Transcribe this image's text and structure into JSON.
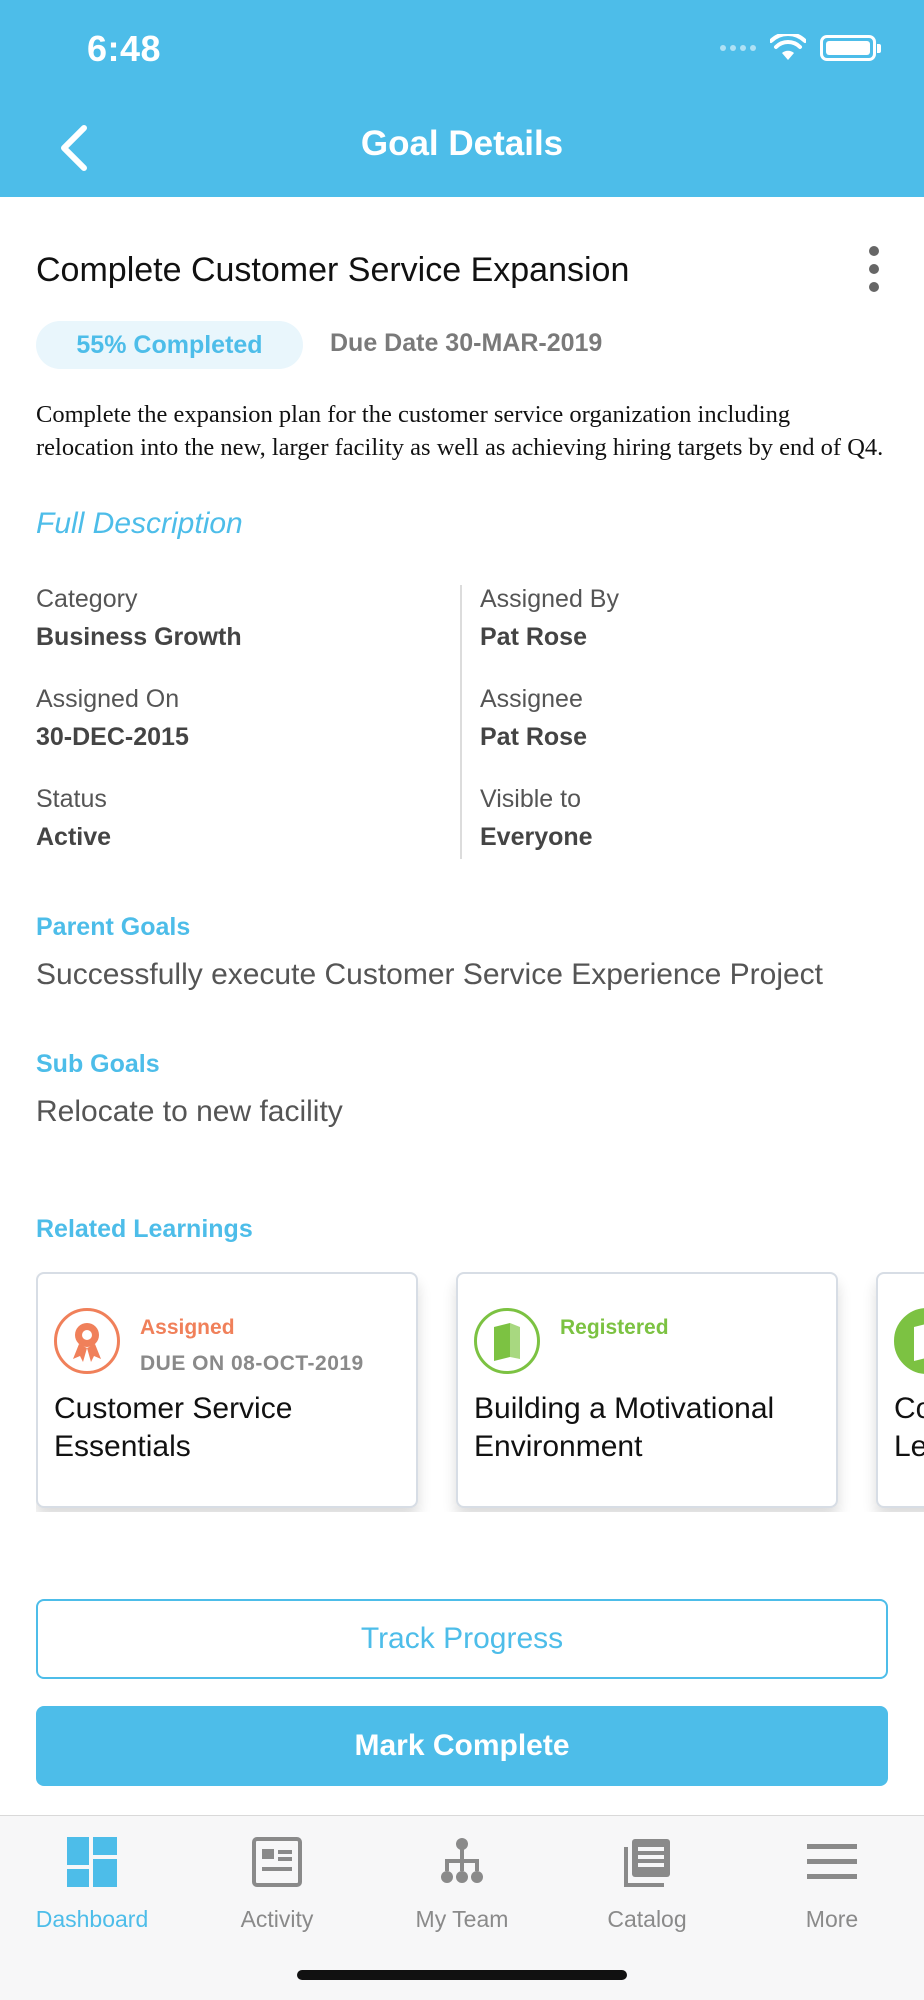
{
  "status_bar": {
    "time": "6:48"
  },
  "header": {
    "title": "Goal Details"
  },
  "goal": {
    "title": "Complete Customer Service Expansion",
    "progress_label": "55% Completed",
    "progress_value": 55,
    "due_date": "Due Date 30-MAR-2019",
    "description": "Complete the expansion plan for the customer service organization including relocation into the new, larger facility as well as achieving hiring targets by end of Q4.",
    "full_description_link": "Full Description"
  },
  "fields": {
    "category_label": "Category",
    "category_value": "Business Growth",
    "assigned_on_label": "Assigned On",
    "assigned_on_value": "30-DEC-2015",
    "status_label": "Status",
    "status_value": "Active",
    "assigned_by_label": "Assigned By",
    "assigned_by_value": "Pat Rose",
    "assignee_label": "Assignee",
    "assignee_value": "Pat Rose",
    "visible_to_label": "Visible to",
    "visible_to_value": "Everyone"
  },
  "parent_goals": {
    "label": "Parent Goals",
    "items": [
      "Successfully execute Customer Service Experience Project"
    ]
  },
  "sub_goals": {
    "label": "Sub Goals",
    "items": [
      "Relocate to new facility"
    ]
  },
  "related_learnings": {
    "label": "Related Learnings",
    "cards": [
      {
        "status": "Assigned",
        "due": "DUE ON 08-OCT-2019",
        "title": "Customer Service Essentials",
        "icon": "award-ribbon-icon",
        "color": "#f0805a"
      },
      {
        "status": "Registered",
        "due": "",
        "title": "Building a Motivational Environment",
        "icon": "book-icon",
        "color": "#7cc242"
      },
      {
        "status": "",
        "due": "",
        "title": "Co Le",
        "icon": "book-icon",
        "color": "#7cc242"
      }
    ]
  },
  "actions": {
    "track_progress": "Track Progress",
    "mark_complete": "Mark Complete"
  },
  "tabbar": {
    "tabs": [
      {
        "label": "Dashboard",
        "icon": "dashboard-icon",
        "active": true
      },
      {
        "label": "Activity",
        "icon": "activity-icon",
        "active": false
      },
      {
        "label": "My Team",
        "icon": "team-icon",
        "active": false
      },
      {
        "label": "Catalog",
        "icon": "catalog-icon",
        "active": false
      },
      {
        "label": "More",
        "icon": "menu-icon",
        "active": false
      }
    ]
  },
  "colors": {
    "accent": "#4dbde9",
    "assigned": "#f0805a",
    "registered": "#7cc242"
  }
}
